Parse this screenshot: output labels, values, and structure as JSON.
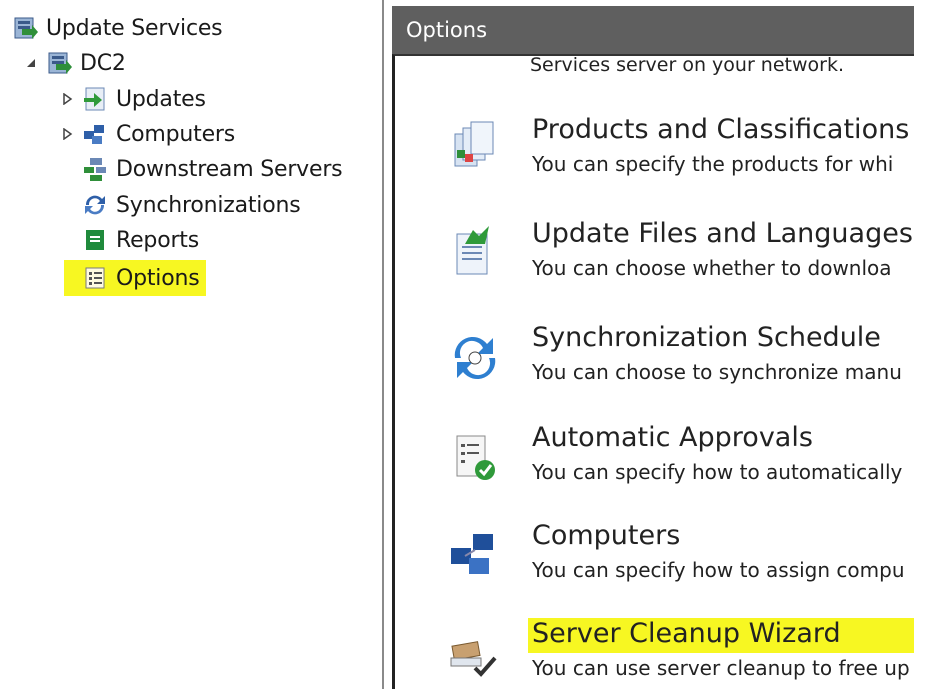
{
  "tree": {
    "root_label": "Update Services",
    "server_label": "DC2",
    "items": [
      {
        "label": "Updates",
        "icon": "updates-icon",
        "expandable": true
      },
      {
        "label": "Computers",
        "icon": "computers-icon",
        "expandable": true
      },
      {
        "label": "Downstream Servers",
        "icon": "downstream-servers-icon",
        "expandable": false
      },
      {
        "label": "Synchronizations",
        "icon": "synchronizations-icon",
        "expandable": false
      },
      {
        "label": "Reports",
        "icon": "reports-icon",
        "expandable": false
      },
      {
        "label": "Options",
        "icon": "options-icon",
        "expandable": false,
        "selected": true
      }
    ]
  },
  "options_pane": {
    "header": "Options",
    "cut_text": "Services server on your network.",
    "items": [
      {
        "title": "Products and Classifications",
        "desc": "You can specify the products for whi",
        "icon": "products-classifications-icon"
      },
      {
        "title": "Update Files and Languages",
        "desc": "You can choose whether to downloa",
        "icon": "update-files-icon"
      },
      {
        "title": "Synchronization Schedule",
        "desc": "You can choose to synchronize manu",
        "icon": "sync-schedule-icon"
      },
      {
        "title": "Automatic Approvals",
        "desc": "You can specify how to automatically",
        "icon": "automatic-approvals-icon"
      },
      {
        "title": "Computers",
        "desc": "You can specify how to assign compu",
        "icon": "computers-option-icon"
      },
      {
        "title": "Server Cleanup Wizard",
        "desc": "You can use server cleanup to free up",
        "icon": "cleanup-wizard-icon",
        "highlighted": true
      }
    ]
  },
  "colors": {
    "highlight": "#f7f722",
    "header_bg": "#5f5f5f",
    "text": "#222222"
  }
}
